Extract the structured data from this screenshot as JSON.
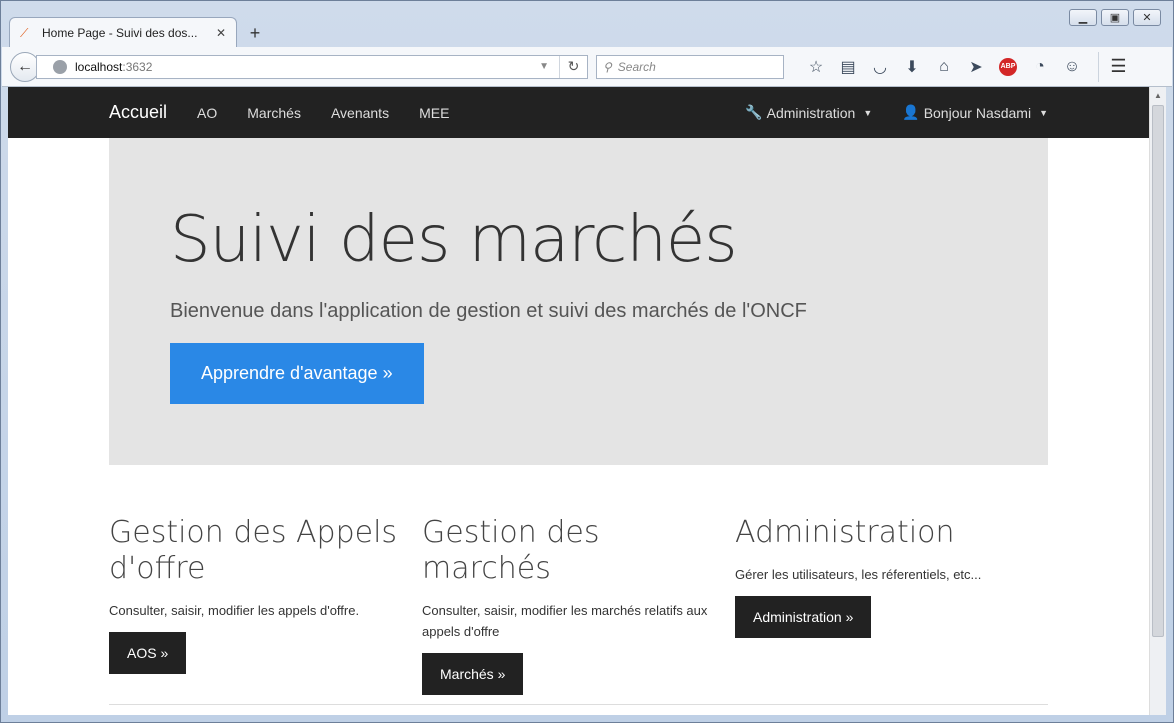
{
  "browser": {
    "tab_title": "Home Page - Suivi des dos...",
    "url_host": "localhost",
    "url_port": ":3632",
    "search_placeholder": "Search"
  },
  "nav": {
    "brand": "Accueil",
    "links": [
      "AO",
      "Marchés",
      "Avenants",
      "MEE"
    ],
    "admin": "Administration",
    "user": "Bonjour Nasdami"
  },
  "jumbotron": {
    "title": "Suivi des marchés",
    "lead": "Bienvenue dans l'application de gestion et suivi des marchés de l'ONCF",
    "button": "Apprendre d'avantage »"
  },
  "sections": [
    {
      "title": "Gestion des Appels d'offre",
      "text": "Consulter, saisir, modifier les appels d'offre.",
      "button": "AOS »"
    },
    {
      "title": "Gestion des marchés",
      "text": "Consulter, saisir, modifier les marchés relatifs aux appels d'offre",
      "button": "Marchés »"
    },
    {
      "title": "Administration",
      "text": "Gérer les utilisateurs, les réferentiels, etc...",
      "button": "Administration »"
    }
  ]
}
